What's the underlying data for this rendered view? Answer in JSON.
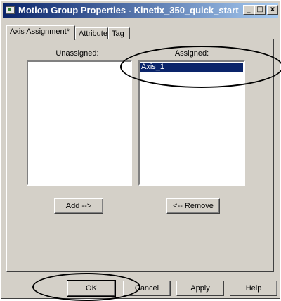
{
  "window": {
    "title": "Motion Group Properties - Kinetix_350_quick_start",
    "controls": {
      "minimize": "_",
      "maximize": "□",
      "close": "x"
    }
  },
  "tabs": [
    {
      "label": "Axis Assignment*",
      "active": true
    },
    {
      "label": "Attribute",
      "active": false
    },
    {
      "label": "Tag",
      "active": false
    }
  ],
  "unassigned": {
    "label": "Unassigned:",
    "items": []
  },
  "assigned": {
    "label": "Assigned:",
    "items": [
      "Axis_1"
    ]
  },
  "buttons": {
    "add": "Add -->",
    "remove": "<-- Remove",
    "ok": "OK",
    "cancel": "Cancel",
    "apply": "Apply",
    "help": "Help"
  },
  "colors": {
    "title_start": "#0a246a",
    "title_end": "#a6caf0",
    "selection": "#0a246a",
    "face": "#d4d0c8"
  }
}
